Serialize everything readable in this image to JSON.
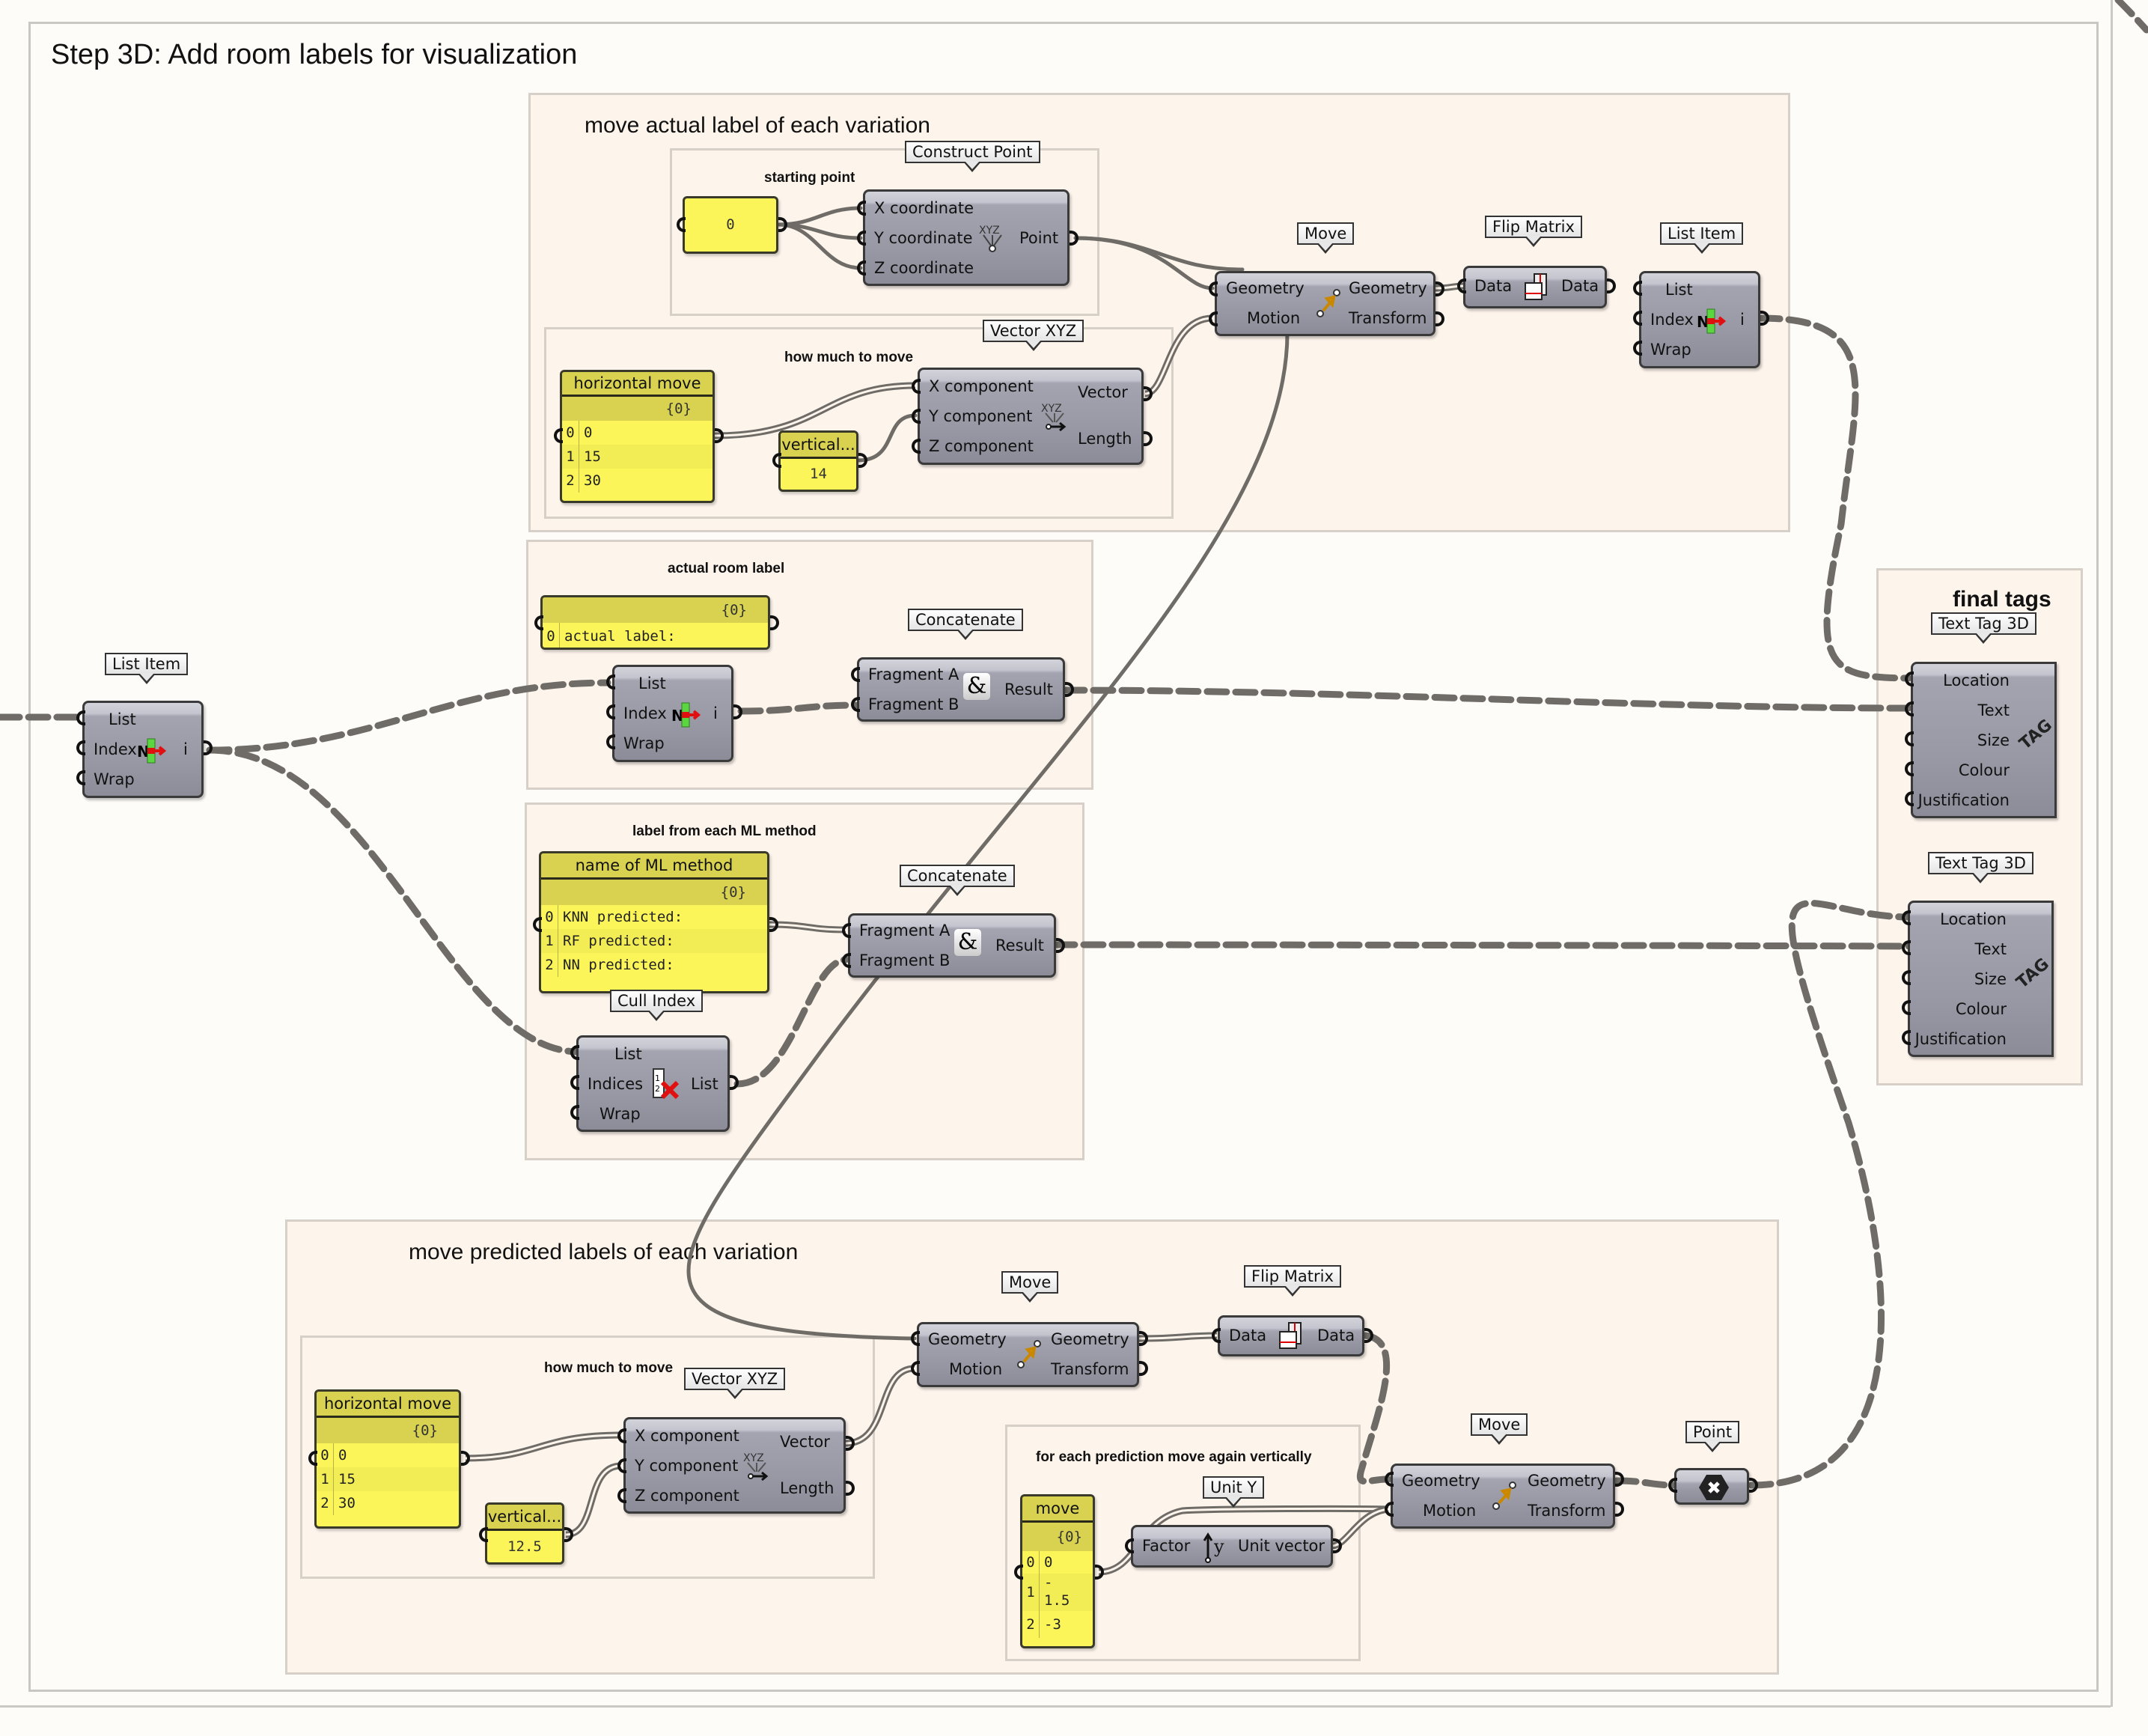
{
  "canvas": {
    "title": "Step 3D: Add room labels for visualization",
    "colors": {
      "background": "#fefcf8",
      "group_fill": "#fdf4ec",
      "component": "#9999a6",
      "panel": "#fbf55a",
      "panel_header": "#d8d250",
      "wire": "#6f6b66"
    }
  },
  "groups": {
    "move_actual": {
      "title": "move actual label of each variation"
    },
    "starting_point": {
      "title": "starting point"
    },
    "how_much_top": {
      "title": "how much to move"
    },
    "actual_room_label": {
      "title": "actual room label"
    },
    "ml_label": {
      "title": "label from each ML method"
    },
    "final_tags": {
      "title": "final tags"
    },
    "move_predicted": {
      "title": "move predicted labels of each variation"
    },
    "how_much_bottom": {
      "title": "how much to move"
    },
    "each_prediction": {
      "title": "for each prediction move again vertically"
    }
  },
  "components": {
    "list_item_left": {
      "tooltip": "List Item",
      "inputs": [
        "List",
        "Index",
        "Wrap"
      ],
      "outputs": [
        "i"
      ]
    },
    "construct_point": {
      "tooltip": "Construct Point",
      "inputs": [
        "X coordinate",
        "Y coordinate",
        "Z coordinate"
      ],
      "outputs": [
        "Point"
      ],
      "icon": "xyz-point-icon"
    },
    "vector_xyz_top": {
      "tooltip": "Vector XYZ",
      "inputs": [
        "X component",
        "Y component",
        "Z component"
      ],
      "outputs": [
        "Vector",
        "Length"
      ]
    },
    "move_top": {
      "tooltip": "Move",
      "inputs": [
        "Geometry",
        "Motion"
      ],
      "outputs": [
        "Geometry",
        "Transform"
      ]
    },
    "flip_matrix_top": {
      "tooltip": "Flip Matrix",
      "inputs": [
        "Data"
      ],
      "outputs": [
        "Data"
      ]
    },
    "list_item_top": {
      "tooltip": "List Item",
      "inputs": [
        "List",
        "Index",
        "Wrap"
      ],
      "outputs": [
        "i"
      ]
    },
    "list_item_mid": {
      "inputs": [
        "List",
        "Index",
        "Wrap"
      ],
      "outputs": [
        "i"
      ]
    },
    "concatenate_1": {
      "tooltip": "Concatenate",
      "inputs": [
        "Fragment A",
        "Fragment B"
      ],
      "outputs": [
        "Result"
      ]
    },
    "concatenate_2": {
      "tooltip": "Concatenate",
      "inputs": [
        "Fragment A",
        "Fragment B"
      ],
      "outputs": [
        "Result"
      ]
    },
    "cull_index": {
      "tooltip": "Cull Index",
      "inputs": [
        "List",
        "Indices",
        "Wrap"
      ],
      "outputs": [
        "List"
      ]
    },
    "text_tag_1": {
      "tooltip": "Text Tag 3D",
      "inputs": [
        "Location",
        "Text",
        "Size",
        "Colour",
        "Justification"
      ],
      "icon_text": "TAG"
    },
    "text_tag_2": {
      "tooltip": "Text Tag 3D",
      "inputs": [
        "Location",
        "Text",
        "Size",
        "Colour",
        "Justification"
      ],
      "icon_text": "TAG"
    },
    "move_bottom_1": {
      "tooltip": "Move",
      "inputs": [
        "Geometry",
        "Motion"
      ],
      "outputs": [
        "Geometry",
        "Transform"
      ]
    },
    "flip_matrix_bottom": {
      "tooltip": "Flip Matrix",
      "inputs": [
        "Data"
      ],
      "outputs": [
        "Data"
      ]
    },
    "vector_xyz_bottom": {
      "tooltip": "Vector XYZ",
      "inputs": [
        "X component",
        "Y component",
        "Z component"
      ],
      "outputs": [
        "Vector",
        "Length"
      ]
    },
    "unit_y": {
      "tooltip": "Unit Y",
      "inputs": [
        "Factor"
      ],
      "outputs": [
        "Unit vector"
      ]
    },
    "move_bottom_2": {
      "tooltip": "Move",
      "inputs": [
        "Geometry",
        "Motion"
      ],
      "outputs": [
        "Geometry",
        "Transform"
      ]
    },
    "point_param": {
      "tooltip": "Point"
    }
  },
  "panels": {
    "starting_point_value": {
      "value": "0"
    },
    "horizontal_move_top": {
      "header": "horizontal move",
      "path": "{0}",
      "rows": [
        {
          "i": "0",
          "v": "0"
        },
        {
          "i": "1",
          "v": "15"
        },
        {
          "i": "2",
          "v": "30"
        }
      ]
    },
    "vertical_top": {
      "header": "vertical...",
      "value": "14"
    },
    "actual_label": {
      "path": "{0}",
      "rows": [
        {
          "i": "0",
          "v": "actual label:"
        }
      ]
    },
    "ml_method": {
      "header": "name of ML method",
      "path": "{0}",
      "rows": [
        {
          "i": "0",
          "v": "KNN predicted:"
        },
        {
          "i": "1",
          "v": "RF predicted:"
        },
        {
          "i": "2",
          "v": "NN predicted:"
        }
      ]
    },
    "horizontal_move_bottom": {
      "header": "horizontal move",
      "path": "{0}",
      "rows": [
        {
          "i": "0",
          "v": "0"
        },
        {
          "i": "1",
          "v": "15"
        },
        {
          "i": "2",
          "v": "30"
        }
      ]
    },
    "vertical_bottom": {
      "header": "vertical...",
      "value": "12.5"
    },
    "move_values": {
      "header": "move",
      "path": "{0}",
      "rows": [
        {
          "i": "0",
          "v": "0"
        },
        {
          "i": "1",
          "v": "-\n1.5"
        },
        {
          "i": "2",
          "v": "-3"
        }
      ]
    }
  }
}
